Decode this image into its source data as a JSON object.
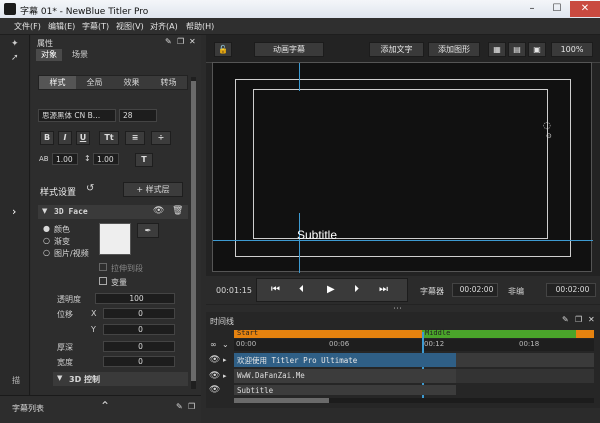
{
  "window": {
    "title": "字幕 01* - NewBlue Titler Pro",
    "minimize": "–",
    "maximize": "☐",
    "close": "✕"
  },
  "menu": [
    "文件(F)",
    "编辑(E)",
    "字幕(T)",
    "视图(V)",
    "对齐(A)",
    "帮助(H)"
  ],
  "leftstrip": {
    "label": "描"
  },
  "properties": {
    "title": "属性",
    "tabs": [
      "对象",
      "场景"
    ],
    "subtabs": [
      "样式",
      "全局",
      "效果",
      "转场"
    ],
    "font_name": "思源黑体 CN B…",
    "font_size": "28",
    "bold": "B",
    "italic": "I",
    "underline": "U",
    "spacing": "1.00",
    "leading": "1.00",
    "style_settings": "样式设置",
    "style_layer": "+ 样式层",
    "face_section": "3D Face",
    "fill_options": [
      "颜色",
      "渐变",
      "图片/视频"
    ],
    "stretch_label": "拉伸到段",
    "transform_label": "变量",
    "opacity_label": "透明度",
    "opacity_value": "100",
    "position_label": "位移",
    "x_label": "X",
    "x_value": "0",
    "y_label": "Y",
    "y_value": "0",
    "depth_label": "厚深",
    "depth_value": "0",
    "width_label": "宽度",
    "width_value": "0",
    "control_section": "3D 控制"
  },
  "bottom": {
    "title": "字幕列表"
  },
  "toolbar": {
    "preset": "动画字幕",
    "add_text": "添加文字",
    "add_shape": "添加图形",
    "zoom": "100%"
  },
  "stage": {
    "subtitle": "Subtitle"
  },
  "transport": {
    "time_left": "00:01:15",
    "subtitle_label": "字幕器",
    "time_mid": "00:02:00",
    "right_label": "非编",
    "time_right": "00:02:00"
  },
  "timeline": {
    "title": "时间线",
    "start_label": "Start",
    "middle_label": "Middle",
    "ticks": [
      "00:00",
      "00:06",
      "00:12",
      "00:18"
    ],
    "tracks": [
      "欢迎使用 Titler Pro Ultimate",
      "WwW.DaFanZai.Me",
      "Subtitle"
    ]
  },
  "colors": {
    "accent": "#3d9ad1",
    "start_bar": "#e5820f",
    "middle_bar": "#4aa42a",
    "selected_track": "#2f5f86"
  }
}
